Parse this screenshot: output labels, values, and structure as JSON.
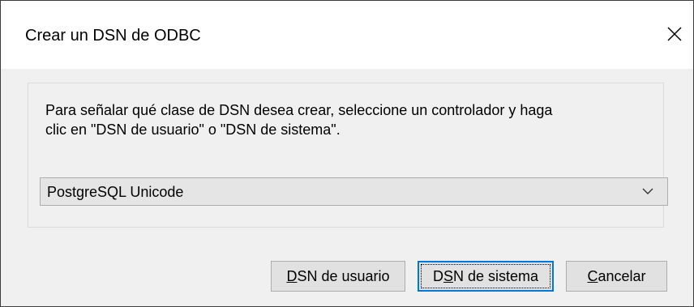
{
  "window": {
    "title": "Crear un DSN de ODBC",
    "close_glyph": "✕"
  },
  "dialog": {
    "instruction_line1": "Para señalar qué clase de DSN desea crear, seleccione un controlador y haga",
    "instruction_line2": "clic en \"DSN de usuario\" o \"DSN de sistema\".",
    "driver_select": {
      "selected": "PostgreSQL Unicode"
    }
  },
  "buttons": {
    "user_dsn": {
      "pre": "",
      "accel": "D",
      "post": "SN de usuario"
    },
    "system_dsn": {
      "pre": "D",
      "accel": "S",
      "post": "N de sistema"
    },
    "cancel": {
      "pre": "",
      "accel": "C",
      "post": "ancelar"
    }
  },
  "icons": {
    "close": "close-icon",
    "dropdown": "chevron-down-icon"
  },
  "colors": {
    "focus_border": "#0078d7",
    "client_background": "#f0f0f0",
    "button_background": "#e1e1e1"
  }
}
